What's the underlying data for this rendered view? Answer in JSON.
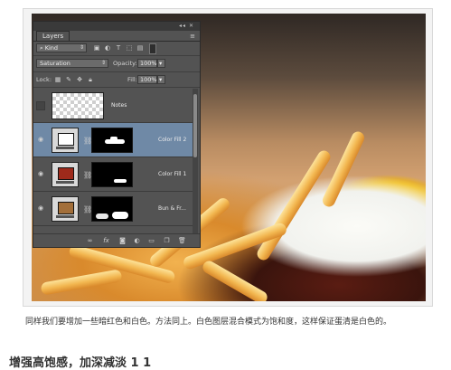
{
  "panel": {
    "tab_label": "Layers",
    "filter_kind": "Kind",
    "blend_mode": "Saturation",
    "opacity_label": "Opacity:",
    "opacity_value": "100%",
    "lock_label": "Lock:",
    "fill_label": "Fill:",
    "fill_value": "100%",
    "layers": [
      {
        "name": "Notes",
        "type": "pixel",
        "visible": false,
        "selected": false
      },
      {
        "name": "Color Fill 2",
        "type": "fill",
        "swatch_color": "#ffffff",
        "visible": true,
        "selected": true
      },
      {
        "name": "Color Fill 1",
        "type": "fill",
        "swatch_color": "#9e2a1b",
        "visible": true,
        "selected": false
      },
      {
        "name": "Bun & Fr...",
        "type": "fill",
        "swatch_color": "#a36f3a",
        "visible": true,
        "selected": false
      }
    ],
    "footer_icons": [
      "link-icon",
      "fx-icon",
      "mask-icon",
      "adjustment-icon",
      "folder-icon",
      "new-layer-icon",
      "trash-icon"
    ]
  },
  "caption": "同样我们要增加一些暗红色和白色。方法同上。白色图层混合模式为饱和度，这样保证蛋清是白色的。",
  "heading": "增强高饱感，加深减淡 1 1"
}
